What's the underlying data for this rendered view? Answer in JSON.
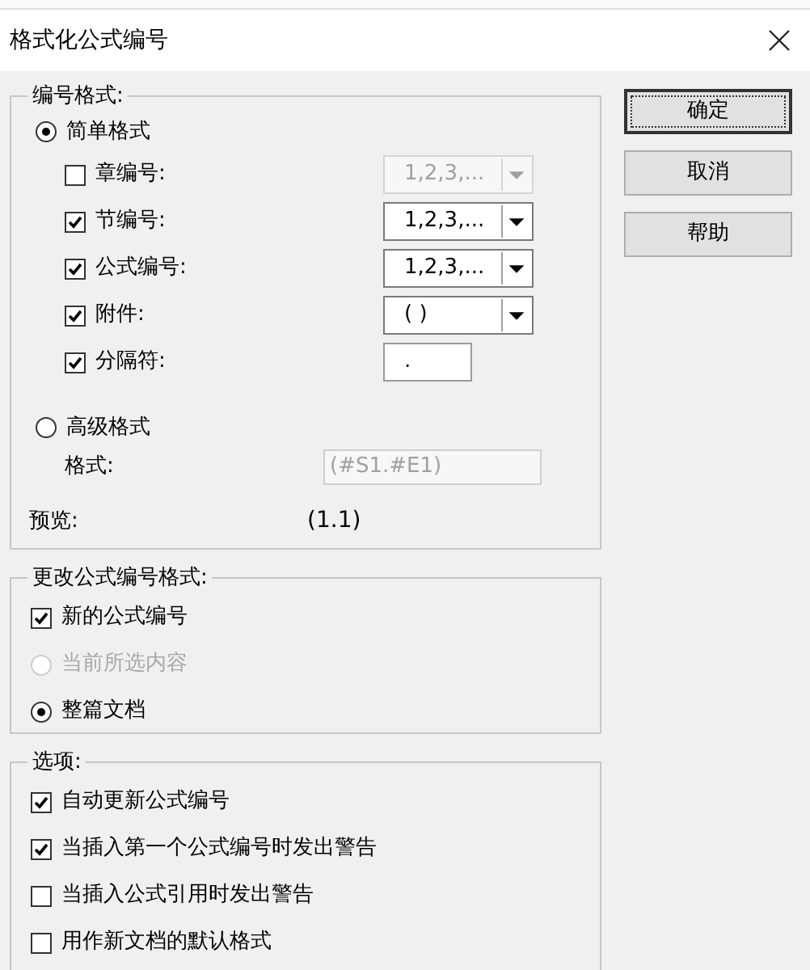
{
  "window": {
    "title": "格式化公式编号"
  },
  "number_format": {
    "legend": "编号格式:",
    "simple": {
      "label": "简单格式",
      "selected": true
    },
    "items": [
      {
        "label": "章编号:",
        "checked": false,
        "kind": "dropdown",
        "value": "1,2,3,...",
        "disabled": true
      },
      {
        "label": "节编号:",
        "checked": true,
        "kind": "dropdown",
        "value": "1,2,3,...",
        "disabled": false
      },
      {
        "label": "公式编号:",
        "checked": true,
        "kind": "dropdown",
        "value": "1,2,3,...",
        "disabled": false
      },
      {
        "label": "附件:",
        "checked": true,
        "kind": "dropdown",
        "value": "( )",
        "disabled": false
      },
      {
        "label": "分隔符:",
        "checked": true,
        "kind": "text",
        "value": ".",
        "disabled": false
      }
    ],
    "advanced": {
      "label": "高级格式",
      "selected": false,
      "format_label": "格式:",
      "format_value": "(#S1.#E1)",
      "disabled": true
    },
    "preview_label": "预览:",
    "preview_value": "(1.1)"
  },
  "change_format": {
    "legend": "更改公式编号格式:",
    "items": [
      {
        "kind": "checkbox",
        "label": "新的公式编号",
        "checked": true,
        "disabled": false
      },
      {
        "kind": "radio",
        "label": "当前所选内容",
        "selected": false,
        "disabled": true
      },
      {
        "kind": "radio",
        "label": "整篇文档",
        "selected": true,
        "disabled": false
      }
    ]
  },
  "options": {
    "legend": "选项:",
    "items": [
      {
        "label": "自动更新公式编号",
        "checked": true
      },
      {
        "label": "当插入第一个公式编号时发出警告",
        "checked": true
      },
      {
        "label": "当插入公式引用时发出警告",
        "checked": false
      },
      {
        "label": "用作新文档的默认格式",
        "checked": false
      }
    ]
  },
  "buttons": [
    {
      "label": "确定",
      "default": true
    },
    {
      "label": "取消",
      "default": false
    },
    {
      "label": "帮助",
      "default": false
    }
  ]
}
